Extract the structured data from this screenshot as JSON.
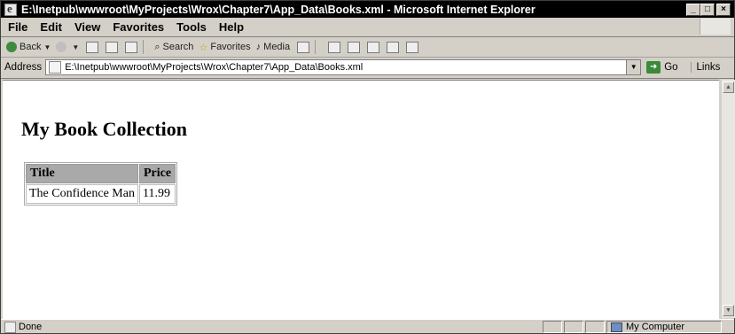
{
  "window": {
    "title": "E:\\Inetpub\\wwwroot\\MyProjects\\Wrox\\Chapter7\\App_Data\\Books.xml - Microsoft Internet Explorer"
  },
  "menu": {
    "items": [
      "File",
      "Edit",
      "View",
      "Favorites",
      "Tools",
      "Help"
    ]
  },
  "toolbar": {
    "back": "Back",
    "search": "Search",
    "favorites": "Favorites",
    "media": "Media"
  },
  "address": {
    "label": "Address",
    "value": "E:\\Inetpub\\wwwroot\\MyProjects\\Wrox\\Chapter7\\App_Data\\Books.xml",
    "go": "Go",
    "links": "Links"
  },
  "page": {
    "heading": "My Book Collection",
    "table": {
      "headers": [
        "Title",
        "Price"
      ],
      "rows": [
        [
          "The Confidence Man",
          "11.99"
        ]
      ]
    }
  },
  "status": {
    "text": "Done",
    "zone": "My Computer"
  }
}
